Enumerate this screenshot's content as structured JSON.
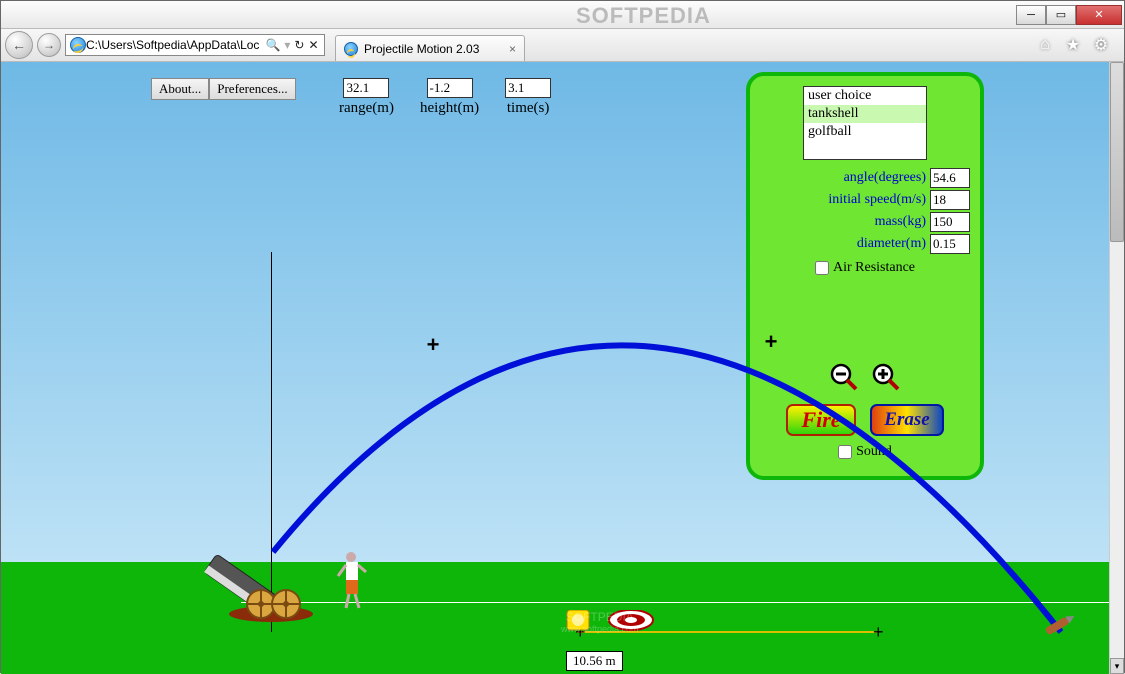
{
  "window": {
    "watermark": "SOFTPEDIA",
    "address_bar": "C:\\Users\\Softpedia\\AppData\\Loc",
    "tab_title": "Projectile Motion 2.03",
    "btn_back": "←",
    "btn_fwd": "→",
    "search_icon": "🔍",
    "refresh_icon": "↻",
    "stop_icon": "✕",
    "home_icon": "⌂",
    "star_icon": "★",
    "gear_icon": "⚙"
  },
  "toolbar": {
    "about": "About...",
    "prefs": "Preferences..."
  },
  "readouts": {
    "range_val": "32.1",
    "range_label": "range(m)",
    "height_val": "-1.2",
    "height_label": "height(m)",
    "time_val": "3.1",
    "time_label": "time(s)"
  },
  "panel": {
    "projectiles": {
      "opt0": "user choice",
      "opt1": "tankshell",
      "opt2": "golfball"
    },
    "angle_label": "angle(degrees)",
    "angle_val": "54.6",
    "speed_label": "initial speed(m/s)",
    "speed_val": "18",
    "mass_label": "mass(kg)",
    "mass_val": "150",
    "diam_label": "diameter(m)",
    "diam_val": "0.15",
    "airres_label": "Air Resistance",
    "fire_label": "Fire",
    "erase_label": "Erase",
    "sound_label": "Sound"
  },
  "scene": {
    "measure_label": "10.56 m",
    "watermark2a": "SOFTPEDIA",
    "watermark2b": "www.softpedia.com"
  },
  "chart_data": {
    "type": "trajectory",
    "note": "Parabolic projectile path; crosses mark sample points; time/labels from readouts",
    "launch_angle_deg": 54.6,
    "initial_speed_mps": 18,
    "mass_kg": 150,
    "diameter_m": 0.15,
    "air_resistance": false,
    "range_m": 32.1,
    "height_m": -1.2,
    "time_s": 3.1,
    "tape_length_m": 10.56,
    "path_points": [
      {
        "x_m": 0.0,
        "y_m": 0.0
      },
      {
        "x_m": 6.0,
        "y_m": 6.5
      },
      {
        "x_m": 12.0,
        "y_m": 9.8
      },
      {
        "x_m": 16.0,
        "y_m": 10.9
      },
      {
        "x_m": 20.0,
        "y_m": 10.6
      },
      {
        "x_m": 26.0,
        "y_m": 7.2
      },
      {
        "x_m": 32.1,
        "y_m": -1.2
      }
    ],
    "marker_points": [
      {
        "x_m": 6.0,
        "y_m": 8.3
      },
      {
        "x_m": 20.2,
        "y_m": 10.6
      }
    ]
  }
}
